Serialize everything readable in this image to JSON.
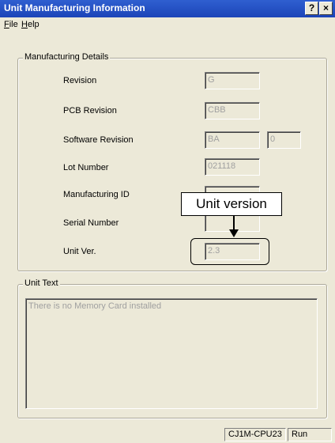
{
  "window": {
    "title": "Unit Manufacturing Information",
    "help_button": "?",
    "close_button": "×"
  },
  "menu": [
    {
      "label": "File",
      "accel": "F",
      "rest": "ile"
    },
    {
      "label": "Help",
      "accel": "H",
      "rest": "elp"
    }
  ],
  "manufacturing": {
    "group_label": "Manufacturing Details",
    "revision": {
      "label": "Revision",
      "value": "G"
    },
    "pcb_revision": {
      "label": "PCB Revision",
      "value": "CBB"
    },
    "software_revision": {
      "label": "Software Revision",
      "value": "BA",
      "value2": "0"
    },
    "lot_number": {
      "label": "Lot Number",
      "value": "021118"
    },
    "manufacturing_id": {
      "label": "Manufacturing ID",
      "value": ""
    },
    "serial_number": {
      "label": "Serial Number",
      "value": ""
    },
    "unit_ver": {
      "label": "Unit Ver.",
      "value": "2.3"
    }
  },
  "unit_text": {
    "group_label": "Unit Text",
    "text": "There is no Memory Card installed"
  },
  "annotation": {
    "callout": "Unit version"
  },
  "status": {
    "model": "CJ1M-CPU23",
    "mode": "Run"
  }
}
